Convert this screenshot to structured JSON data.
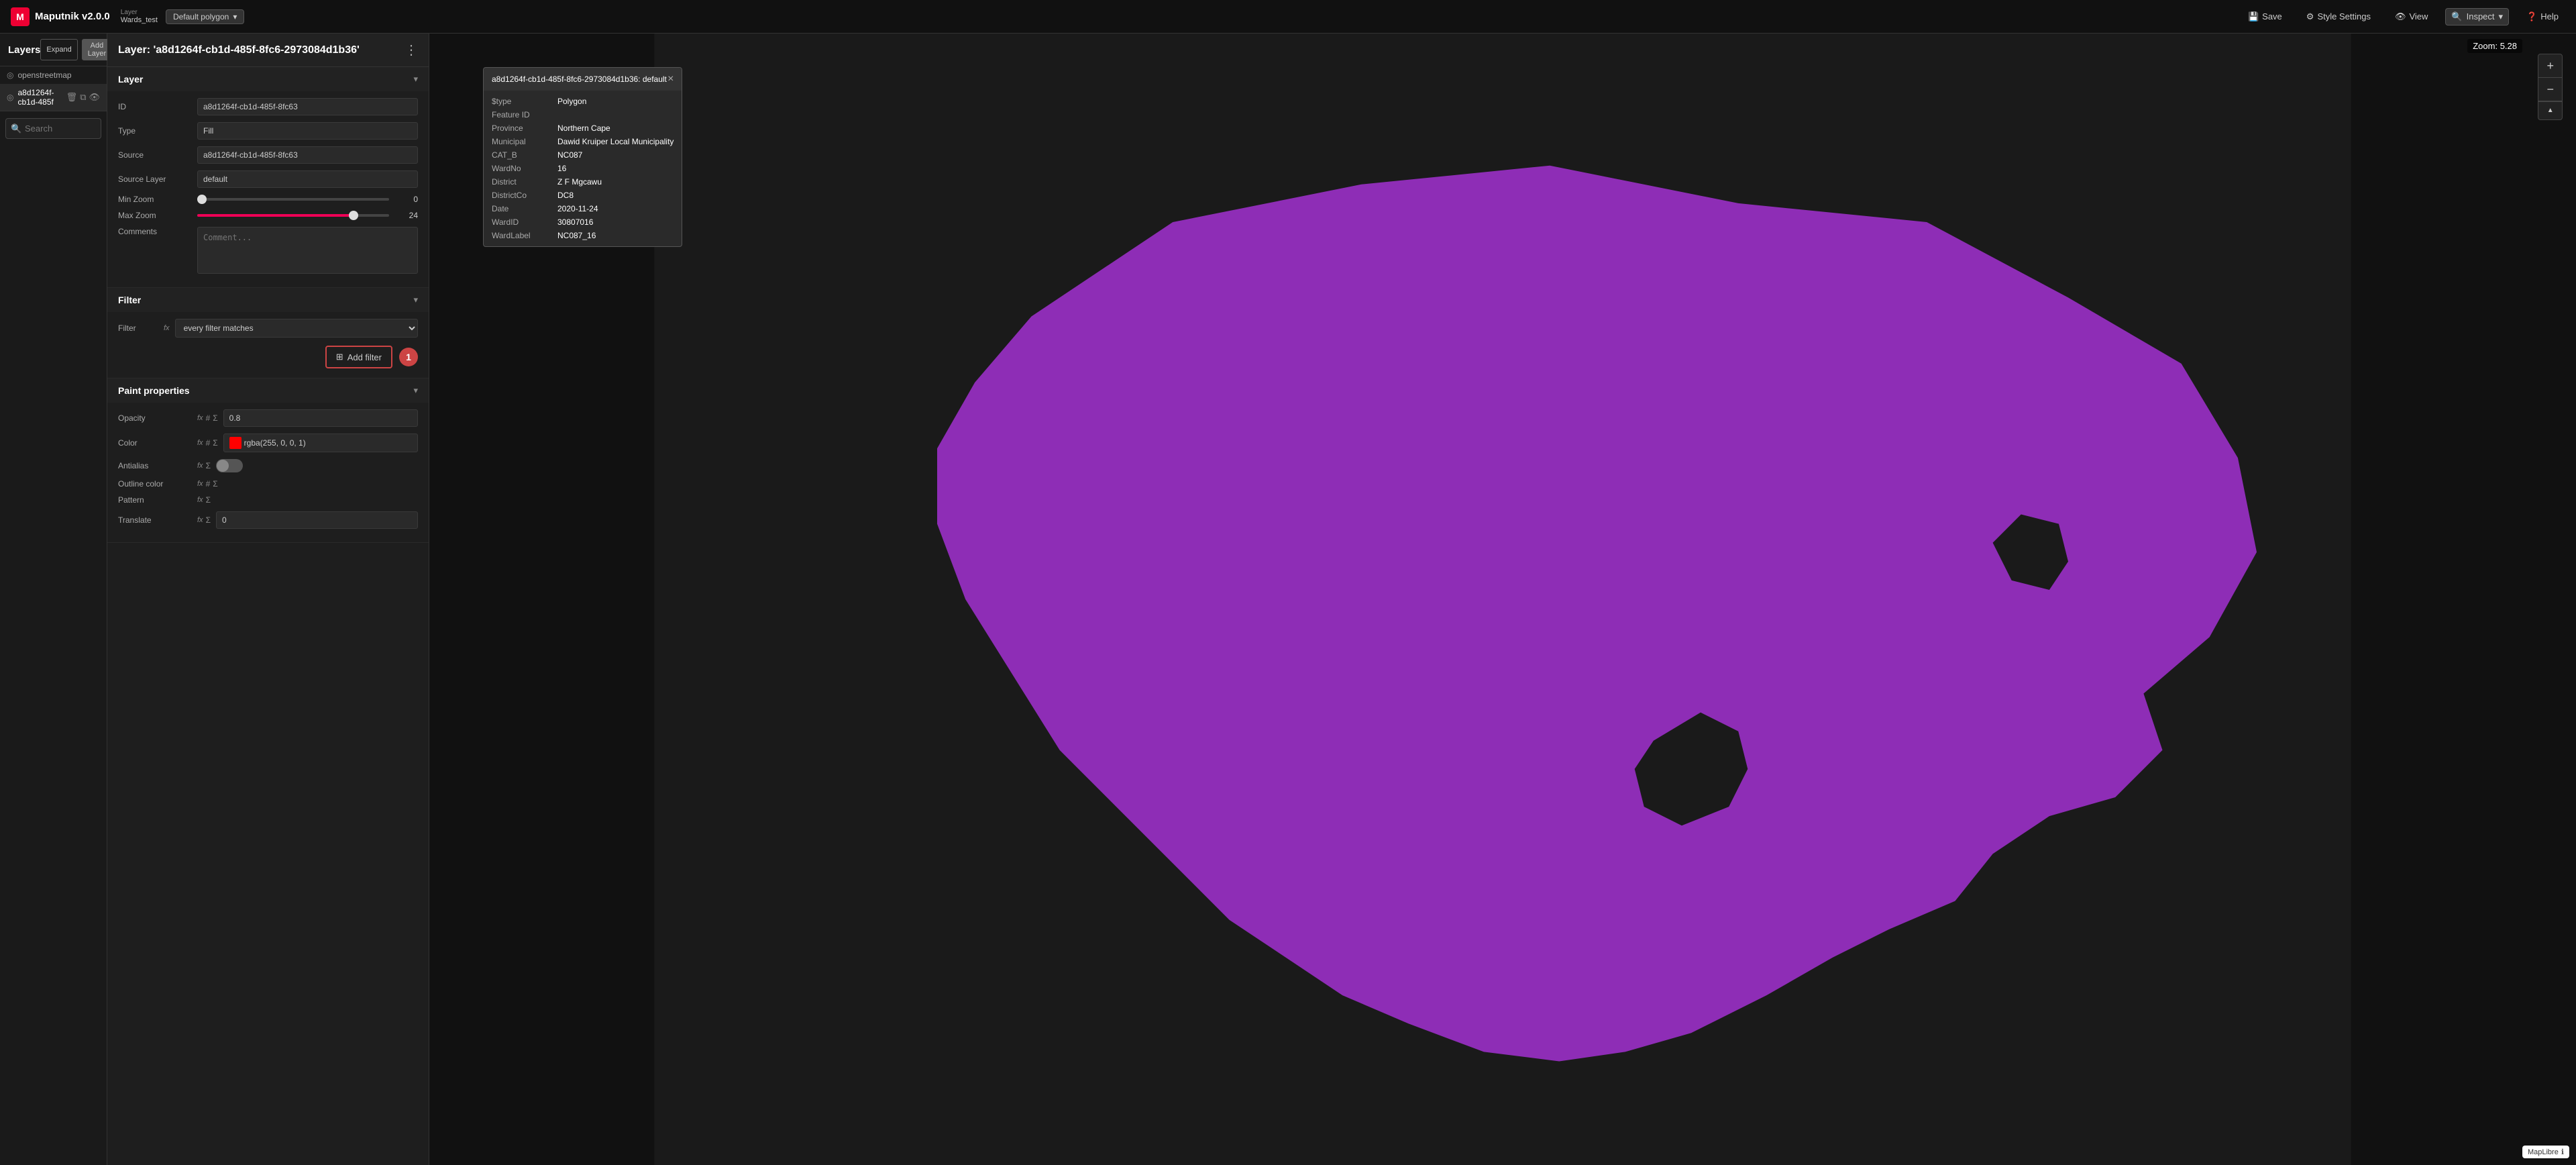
{
  "topbar": {
    "logo_text": "Maputnik v2.0.0",
    "layer_label": "Layer",
    "layer_name": "Wards_test",
    "layer_type": "Default polygon",
    "save_label": "Save",
    "style_settings_label": "Style Settings",
    "view_label": "View",
    "inspect_label": "Inspect",
    "help_label": "Help",
    "zoom_text": "Zoom: 5.28"
  },
  "sidebar": {
    "title": "Layers",
    "expand_btn": "Expand",
    "add_layer_btn": "Add Layer",
    "layers": [
      {
        "name": "openstreetmap",
        "type": "base"
      },
      {
        "name": "a8d1264f-cb1d-485f",
        "type": "fill",
        "active": true
      }
    ]
  },
  "search": {
    "placeholder": "Search"
  },
  "panel": {
    "title": "Layer: 'a8d1264f-cb1d-485f-8fc6-2973084d1b36'",
    "menu_icon": "⋮"
  },
  "layer_section": {
    "title": "Layer",
    "id_label": "ID",
    "id_value": "a8d1264f-cb1d-485f-8fc63",
    "type_label": "Type",
    "type_value": "Fill",
    "source_label": "Source",
    "source_value": "a8d1264f-cb1d-485f-8fc63",
    "source_layer_label": "Source Layer",
    "source_layer_value": "default",
    "min_zoom_label": "Min Zoom",
    "min_zoom_value": "0",
    "min_zoom_pct": 0,
    "max_zoom_label": "Max Zoom",
    "max_zoom_value": "24",
    "max_zoom_pct": 83,
    "comments_label": "Comments",
    "comments_placeholder": "Comment..."
  },
  "filter_section": {
    "title": "Filter",
    "filter_label": "Filter",
    "filter_value": "every filter matches",
    "add_filter_label": "Add filter",
    "badge": "1"
  },
  "paint_section": {
    "title": "Paint properties",
    "opacity_label": "Opacity",
    "opacity_value": "0.8",
    "color_label": "Color",
    "color_value": "rgba(255, 0, 0, 1)",
    "color_hex": "#ff0000",
    "antialias_label": "Antialias",
    "outline_color_label": "Outline color",
    "pattern_label": "Pattern",
    "translate_label": "Translate",
    "translate_value": "0"
  },
  "feature_popup": {
    "title": "a8d1264f-cb1d-485f-8fc6-2973084d1b36: default",
    "fields": [
      {
        "key": "$type",
        "value": "Polygon"
      },
      {
        "key": "Feature ID",
        "value": ""
      },
      {
        "key": "Province",
        "value": "Northern Cape"
      },
      {
        "key": "Municipal",
        "value": "Dawid Kruiper Local Municipality"
      },
      {
        "key": "CAT_B",
        "value": "NC087"
      },
      {
        "key": "WardNo",
        "value": "16"
      },
      {
        "key": "District",
        "value": "Z F Mgcawu"
      },
      {
        "key": "DistrictCo",
        "value": "DC8"
      },
      {
        "key": "Date",
        "value": "2020-11-24"
      },
      {
        "key": "WardID",
        "value": "30807016"
      },
      {
        "key": "WardLabel",
        "value": "NC087_16"
      }
    ]
  },
  "maplibre": {
    "badge": "MapLibre"
  }
}
